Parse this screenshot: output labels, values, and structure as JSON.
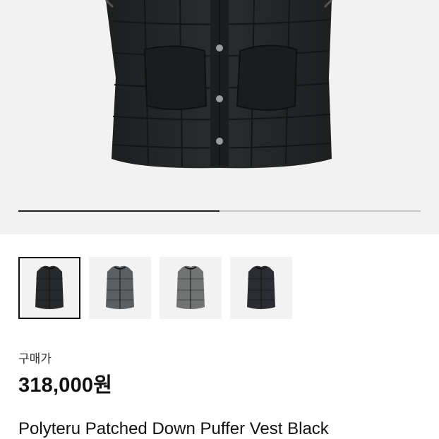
{
  "product": {
    "price_label": "구매가",
    "price": "318,000원",
    "title": "Polyteru Patched Down Puffer Vest Black"
  },
  "gallery": {
    "image_progress": 0.5,
    "thumbnails": [
      {
        "color": "#262829",
        "selected": true
      },
      {
        "color": "#5b5f61",
        "selected": false
      },
      {
        "color": "#717272",
        "selected": false
      },
      {
        "color": "#2b2d33",
        "selected": false
      }
    ]
  },
  "colors": {
    "hero_bg": "#f2f2f2",
    "vest_main": "#222526",
    "accent_text": "#111111"
  }
}
